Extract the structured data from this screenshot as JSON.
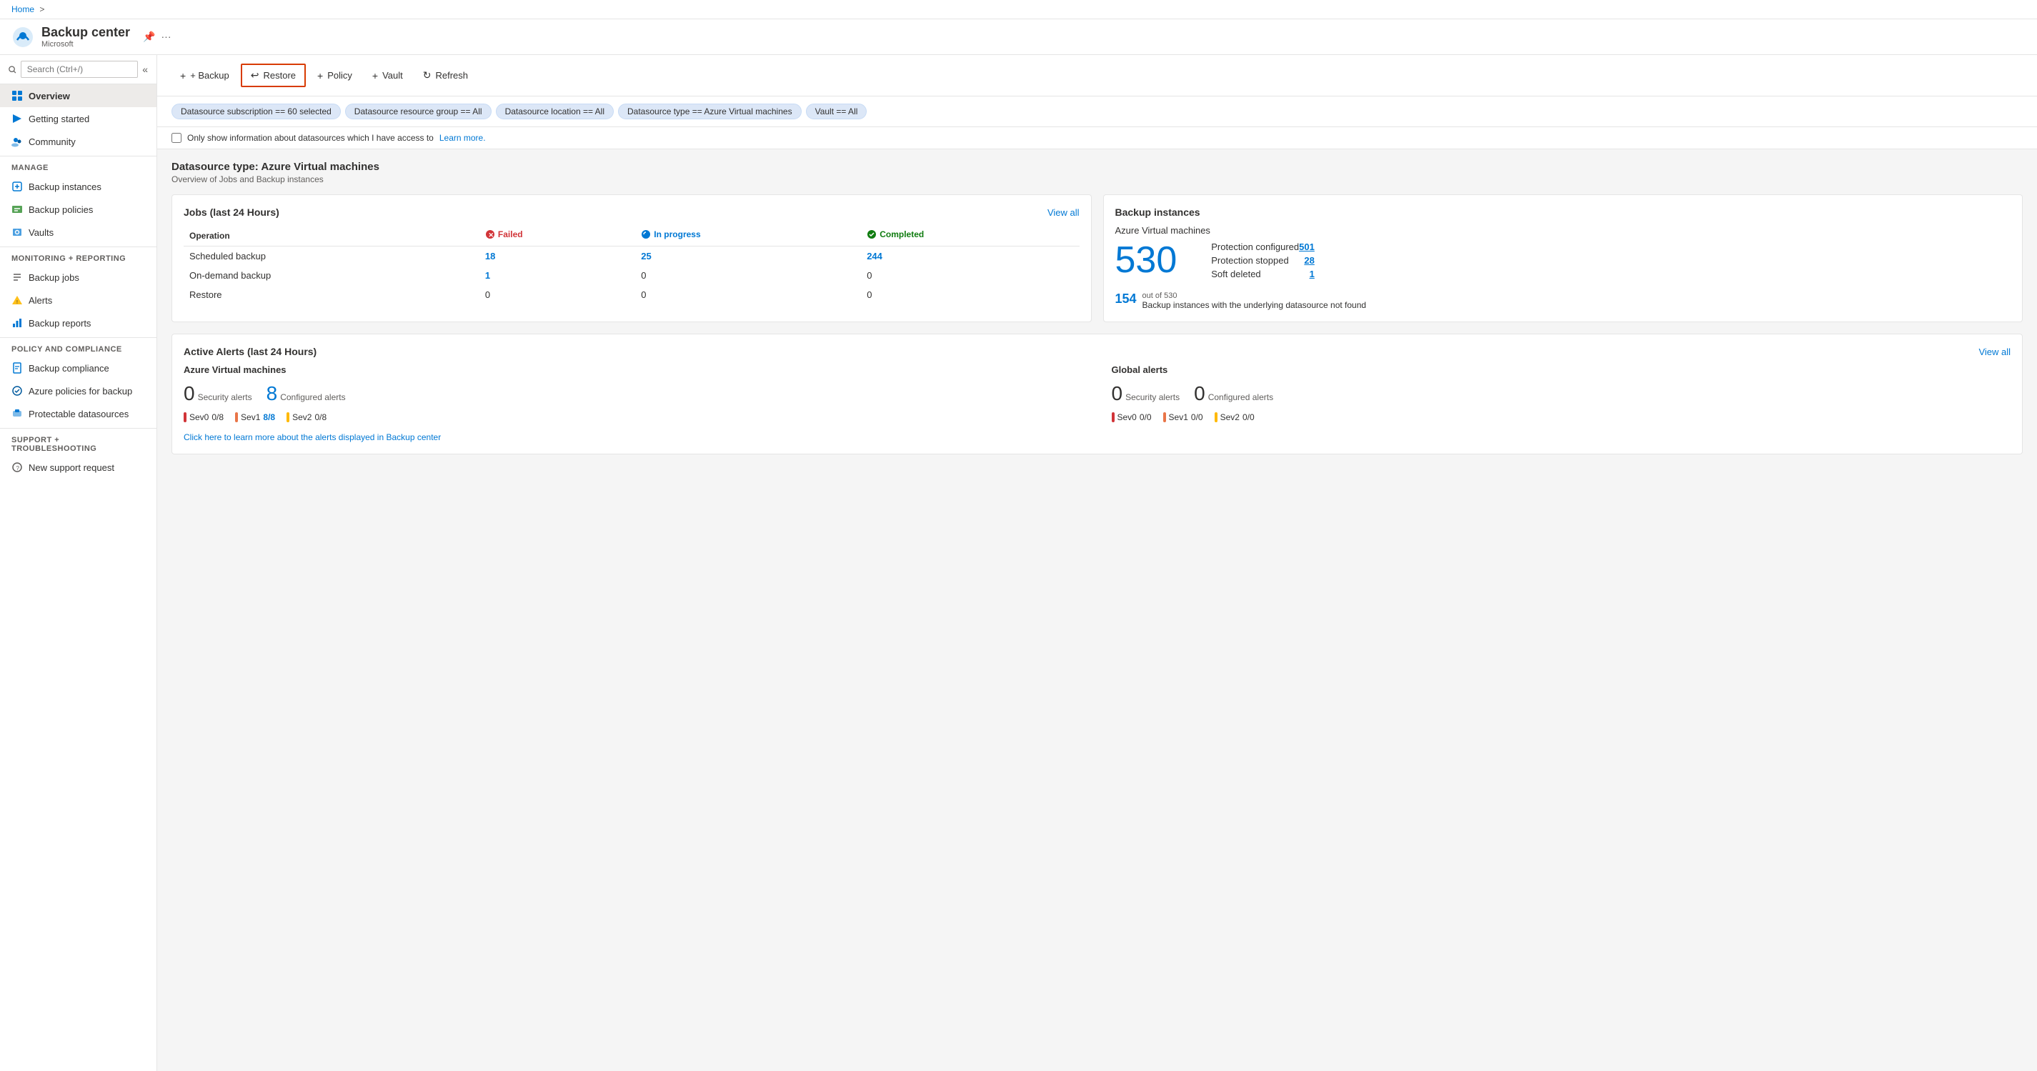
{
  "breadcrumb": {
    "home": "Home",
    "separator": ">"
  },
  "appHeader": {
    "title": "Backup center",
    "subtitle": "Microsoft",
    "pinIcon": "📌",
    "moreIcon": "..."
  },
  "sidebar": {
    "searchPlaceholder": "Search (Ctrl+/)",
    "collapseLabel": "«",
    "items": [
      {
        "id": "overview",
        "label": "Overview",
        "active": true,
        "icon": "grid"
      },
      {
        "id": "getting-started",
        "label": "Getting started",
        "active": false,
        "icon": "rocket"
      },
      {
        "id": "community",
        "label": "Community",
        "active": false,
        "icon": "people"
      }
    ],
    "sections": [
      {
        "label": "Manage",
        "items": [
          {
            "id": "backup-instances",
            "label": "Backup instances",
            "icon": "box"
          },
          {
            "id": "backup-policies",
            "label": "Backup policies",
            "icon": "table"
          },
          {
            "id": "vaults",
            "label": "Vaults",
            "icon": "vault"
          }
        ]
      },
      {
        "label": "Monitoring + reporting",
        "items": [
          {
            "id": "backup-jobs",
            "label": "Backup jobs",
            "icon": "list"
          },
          {
            "id": "alerts",
            "label": "Alerts",
            "icon": "alert"
          },
          {
            "id": "backup-reports",
            "label": "Backup reports",
            "icon": "chart"
          }
        ]
      },
      {
        "label": "Policy and compliance",
        "items": [
          {
            "id": "backup-compliance",
            "label": "Backup compliance",
            "icon": "compliance"
          },
          {
            "id": "azure-policies",
            "label": "Azure policies for backup",
            "icon": "policy"
          },
          {
            "id": "protectable-datasources",
            "label": "Protectable datasources",
            "icon": "datasource"
          }
        ]
      },
      {
        "label": "Support + troubleshooting",
        "items": [
          {
            "id": "new-support-request",
            "label": "New support request",
            "icon": "support"
          }
        ]
      }
    ]
  },
  "toolbar": {
    "backup_label": "+ Backup",
    "restore_label": "↩ Restore",
    "policy_label": "+ Policy",
    "vault_label": "+ Vault",
    "refresh_label": "↻ Refresh",
    "restore_highlighted": true
  },
  "filterBar": {
    "filters": [
      {
        "id": "subscription",
        "label": "Datasource subscription == 60 selected"
      },
      {
        "id": "resource-group",
        "label": "Datasource resource group == All"
      },
      {
        "id": "location",
        "label": "Datasource location == All"
      },
      {
        "id": "datasource-type",
        "label": "Datasource type == Azure Virtual machines"
      },
      {
        "id": "vault",
        "label": "Vault == All"
      }
    ]
  },
  "checkboxRow": {
    "label": "Only show information about datasources which I have access to",
    "linkText": "Learn more.",
    "checked": false
  },
  "mainSection": {
    "title": "Datasource type: Azure Virtual machines",
    "subtitle": "Overview of Jobs and Backup instances"
  },
  "jobsCard": {
    "title": "Jobs (last 24 Hours)",
    "viewAllLabel": "View all",
    "columns": {
      "operation": "Operation",
      "failed": "Failed",
      "inprogress": "In progress",
      "completed": "Completed"
    },
    "rows": [
      {
        "operation": "Scheduled backup",
        "failed": "18",
        "inprogress": "25",
        "completed": "244"
      },
      {
        "operation": "On-demand backup",
        "failed": "1",
        "inprogress": "0",
        "completed": "0"
      },
      {
        "operation": "Restore",
        "failed": "0",
        "inprogress": "0",
        "completed": "0"
      }
    ]
  },
  "backupInstancesCard": {
    "title": "Backup instances",
    "subtitle": "Azure Virtual machines",
    "bigNumber": "530",
    "stats": [
      {
        "label": "Protection configured",
        "value": "501"
      },
      {
        "label": "Protection stopped",
        "value": "28"
      },
      {
        "label": "Soft deleted",
        "value": "1"
      }
    ],
    "footnoteNumber": "154",
    "footnoteText": "out of 530",
    "footnoteDesc": "Backup instances with the underlying datasource not found"
  },
  "alertsCard": {
    "title": "Active Alerts (last 24 Hours)",
    "viewAllLabel": "View all",
    "groups": [
      {
        "title": "Azure Virtual machines",
        "securityAlertsNum": "0",
        "securityAlertsLabel": "Security alerts",
        "configuredAlertsNum": "8",
        "configuredAlertsLabel": "Configured alerts",
        "sevItems": [
          {
            "sev": "Sev0",
            "color": "red",
            "value": "0/8"
          },
          {
            "sev": "Sev1",
            "color": "orange",
            "value": "8/8",
            "highlight": true
          },
          {
            "sev": "Sev2",
            "color": "yellow",
            "value": "0/8"
          }
        ]
      },
      {
        "title": "Global alerts",
        "securityAlertsNum": "0",
        "securityAlertsLabel": "Security alerts",
        "configuredAlertsNum": "0",
        "configuredAlertsLabel": "Configured alerts",
        "sevItems": [
          {
            "sev": "Sev0",
            "color": "red",
            "value": "0/0"
          },
          {
            "sev": "Sev1",
            "color": "orange",
            "value": "0/0"
          },
          {
            "sev": "Sev2",
            "color": "yellow",
            "value": "0/0"
          }
        ]
      }
    ],
    "linkText": "Click here to learn more about the alerts displayed in Backup center"
  }
}
